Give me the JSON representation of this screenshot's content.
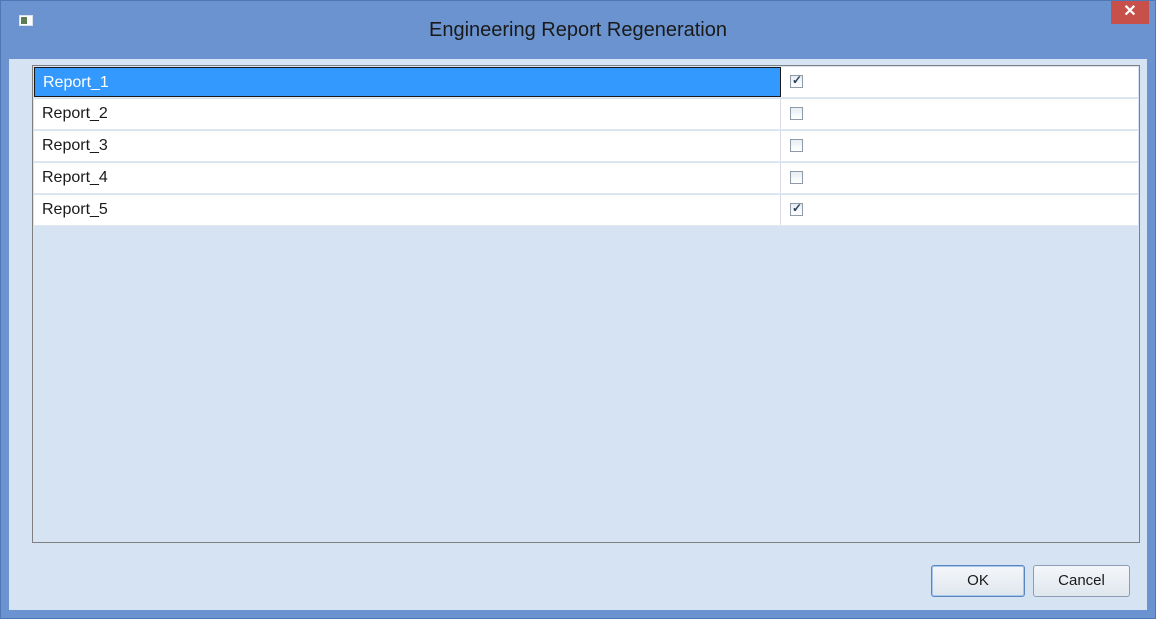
{
  "window": {
    "title": "Engineering Report Regeneration",
    "close_glyph": "✕"
  },
  "reports": [
    {
      "name": "Report_1",
      "checked": true,
      "selected": true
    },
    {
      "name": "Report_2",
      "checked": false,
      "selected": false
    },
    {
      "name": "Report_3",
      "checked": false,
      "selected": false
    },
    {
      "name": "Report_4",
      "checked": false,
      "selected": false
    },
    {
      "name": "Report_5",
      "checked": true,
      "selected": false
    }
  ],
  "buttons": {
    "ok_label": "OK",
    "cancel_label": "Cancel"
  },
  "icons": {
    "app": "app-window-icon",
    "close": "close-icon",
    "check": "checkbox-check-icon"
  },
  "colors": {
    "titlebar": "#6a93cf",
    "selection": "#3399ff",
    "close": "#c7504b",
    "client": "#d6e3f2"
  }
}
